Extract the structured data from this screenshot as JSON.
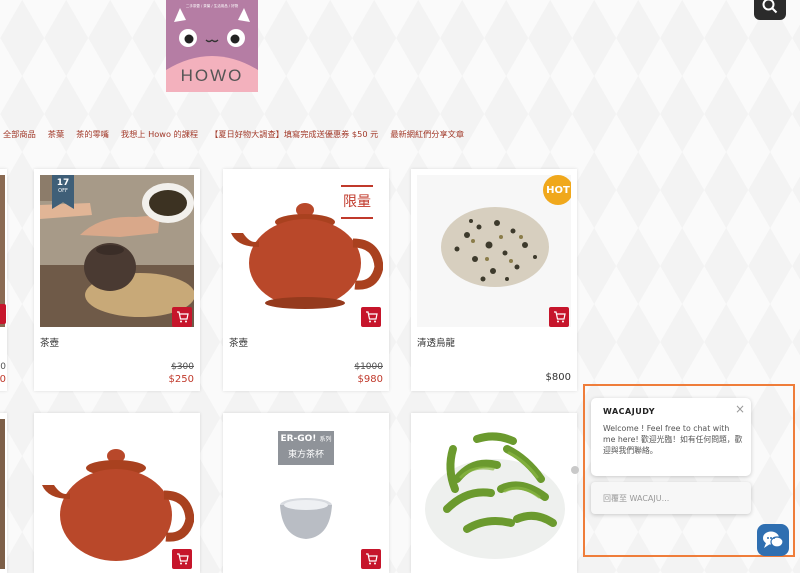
{
  "header": {
    "search_icon": "search-icon",
    "logo_tagline": "二手茶壺 / 茶葉 / 生活用品 / 好物",
    "logo_text": "HOWO"
  },
  "nav": {
    "items": [
      "全部商品",
      "茶葉",
      "茶的零嘴",
      "我想上 Howo 的課程",
      "【夏日好物大調查】填寫完成送優惠券 $50 元",
      "最新網紅們分享文章"
    ]
  },
  "badges": {
    "discount_percent": "17",
    "discount_off": "OFF",
    "limited": "限量",
    "hot": "HOT",
    "brand_ergo": "ER-GO!",
    "brand_series": "系列",
    "brand_sub": "東方茶杯"
  },
  "products": [
    {
      "name": "茶壺",
      "old_price": "$300",
      "price": "$250"
    },
    {
      "name": "茶壺",
      "old_price": "$1000",
      "price": "$980"
    },
    {
      "name": "清透烏龍",
      "price": "$800"
    }
  ],
  "left_card": {
    "old_price": "0",
    "price": "0"
  },
  "chat": {
    "name": "WACAJUDY",
    "close": "×",
    "message": "Welcome ! Feel free to chat with me here! 歡迎光臨！如有任何問題，歡迎與我們聯絡。",
    "reply_placeholder": "回覆至 WACAJU..."
  },
  "colors": {
    "accent": "#c6152b",
    "nav_text": "#a23a2a",
    "chat_button": "#2f6fb1",
    "highlight": "#ef7d3a"
  }
}
